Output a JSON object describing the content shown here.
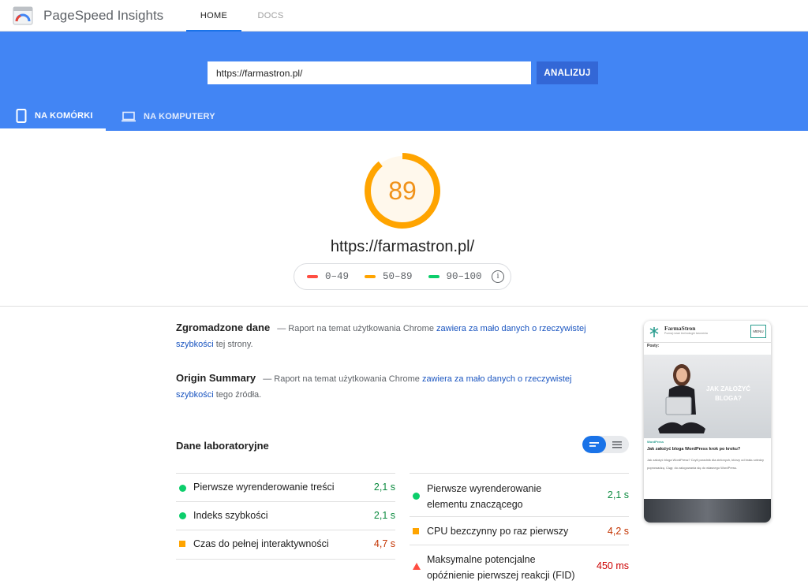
{
  "header": {
    "app_title": "PageSpeed Insights",
    "tabs": [
      {
        "label": "HOME",
        "active": true
      },
      {
        "label": "DOCS",
        "active": false
      }
    ]
  },
  "search": {
    "url_value": "https://farmastron.pl/",
    "analyze_label": "ANALIZUJ"
  },
  "device_tabs": [
    {
      "label": "NA KOMÓRKI",
      "icon": "phone-icon",
      "active": true
    },
    {
      "label": "NA KOMPUTERY",
      "icon": "laptop-icon",
      "active": false
    }
  ],
  "score": {
    "value": "89",
    "url": "https://farmastron.pl/",
    "legend": [
      {
        "range": "0–49",
        "color": "#ff4e42"
      },
      {
        "range": "50–89",
        "color": "#ffa400"
      },
      {
        "range": "90–100",
        "color": "#0cce6b"
      }
    ],
    "info_glyph": "i",
    "gauge_color": "#ffa400"
  },
  "field_data": {
    "title": "Zgromadzone dane",
    "text_before": "— Raport na temat użytkowania Chrome",
    "link": "zawiera za mało danych o rzeczywistej szybkości",
    "text_after": "tej strony."
  },
  "origin_summary": {
    "title": "Origin Summary",
    "text_before": "— Raport na temat użytkowania Chrome",
    "link": "zawiera za mało danych o rzeczywistej szybkości",
    "text_after": "tego źródła."
  },
  "lab_data": {
    "title": "Dane laboratoryjne",
    "left_metrics": [
      {
        "label": "Pierwsze wyrenderowanie treści",
        "value": "2,1 s",
        "status": "pass"
      },
      {
        "label": "Indeks szybkości",
        "value": "2,1 s",
        "status": "pass"
      },
      {
        "label": "Czas do pełnej interaktywności",
        "value": "4,7 s",
        "status": "average"
      }
    ],
    "right_metrics": [
      {
        "label_line1": "Pierwsze wyrenderowanie",
        "label_line2": "elementu znaczącego",
        "value": "2,1 s",
        "status": "pass"
      },
      {
        "label": "CPU bezczynny po raz pierwszy",
        "value": "4,2 s",
        "status": "average"
      },
      {
        "label_line1": "Maksymalne potencjalne",
        "label_line2": "opóźnienie pierwszej reakcji (FID)",
        "value": "450 ms",
        "status": "fail"
      }
    ]
  },
  "thumbnail": {
    "brand": "FarmaStron",
    "tagline": "Poznaj nowe technologie tworzenia",
    "menu_label": "MENU",
    "posts_label": "Posty:",
    "hero_text_line1": "JAK ZAŁOŻYĆ",
    "hero_text_line2": "BLOGA?",
    "category": "WordPress",
    "post_title": "Jak założyć bloga WordPress krok po kroku?",
    "excerpt": "Jak założyć bloga WordPress? Czyli poradnik dla zielonych, którzy od braku wiedzy poprowadzą. Ciąg: do zalogowania się do własnego WordPress."
  }
}
